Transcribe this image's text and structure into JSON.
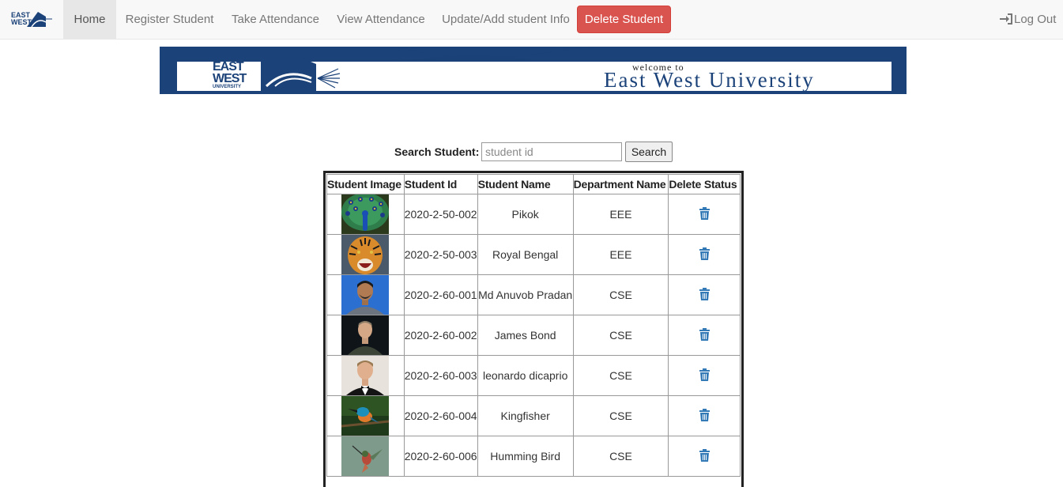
{
  "nav": {
    "items": [
      {
        "label": "Home",
        "active": true
      },
      {
        "label": "Register Student",
        "active": false
      },
      {
        "label": "Take Attendance",
        "active": false
      },
      {
        "label": "View Attendance",
        "active": false
      },
      {
        "label": "Update/Add student Info",
        "active": false
      }
    ],
    "delete_button": "Delete Student",
    "logout": "Log Out",
    "logo_text": "EAST WEST"
  },
  "banner": {
    "welcome": "welcome to",
    "title": "East West University",
    "logo_line1": "EAST",
    "logo_line2": "WEST",
    "logo_line3": "UNIVERSITY"
  },
  "search": {
    "label": "Search Student:",
    "placeholder": "student id",
    "value": "",
    "button": "Search"
  },
  "table": {
    "headers": [
      "Student Image",
      "Student Id",
      "Student Name",
      "Department Name",
      "Delete Status"
    ],
    "rows": [
      {
        "id": "2020-2-50-002",
        "name": "Pikok",
        "dept": "EEE",
        "image": "peacock-photo"
      },
      {
        "id": "2020-2-50-003",
        "name": "Royal Bengal",
        "dept": "EEE",
        "image": "tiger-photo"
      },
      {
        "id": "2020-2-60-001",
        "name": "Md Anuvob Pradan",
        "dept": "CSE",
        "image": "student-portrait-photo"
      },
      {
        "id": "2020-2-60-002",
        "name": "James Bond",
        "dept": "CSE",
        "image": "man-in-suit-photo"
      },
      {
        "id": "2020-2-60-003",
        "name": "leonardo dicaprio",
        "dept": "CSE",
        "image": "man-in-tuxedo-photo"
      },
      {
        "id": "2020-2-60-004",
        "name": "Kingfisher",
        "dept": "CSE",
        "image": "kingfisher-photo"
      },
      {
        "id": "2020-2-60-006",
        "name": "Humming Bird",
        "dept": "CSE",
        "image": "hummingbird-photo"
      }
    ],
    "delete_icon": "trash-icon"
  },
  "colors": {
    "navbar_bg": "#f8f8f8",
    "danger": "#d9534f",
    "brand_blue": "#1b4279",
    "icon_blue": "#337ab7"
  }
}
